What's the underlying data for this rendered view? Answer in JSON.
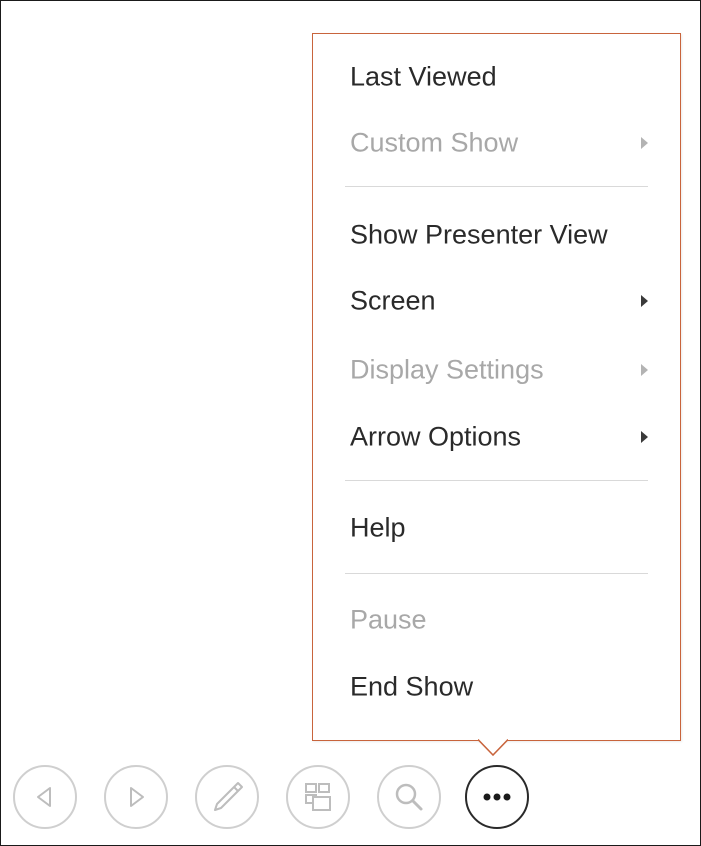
{
  "menu": {
    "items": [
      {
        "label": "Last Viewed",
        "disabled": false,
        "submenu": false
      },
      {
        "label": "Custom Show",
        "disabled": true,
        "submenu": true
      },
      {
        "label": "Show Presenter View",
        "disabled": false,
        "submenu": false
      },
      {
        "label": "Screen",
        "disabled": false,
        "submenu": true
      },
      {
        "label": "Display Settings",
        "disabled": true,
        "submenu": true
      },
      {
        "label": "Arrow Options",
        "disabled": false,
        "submenu": true
      },
      {
        "label": "Help",
        "disabled": false,
        "submenu": false
      },
      {
        "label": "Pause",
        "disabled": true,
        "submenu": false
      },
      {
        "label": "End Show",
        "disabled": false,
        "submenu": false
      }
    ]
  },
  "toolbar": {
    "buttons": [
      {
        "name": "previous-slide-button",
        "icon": "triangle-left-icon",
        "active": false
      },
      {
        "name": "next-slide-button",
        "icon": "triangle-right-icon",
        "active": false
      },
      {
        "name": "pen-button",
        "icon": "pen-icon",
        "active": false
      },
      {
        "name": "see-all-slides-button",
        "icon": "slides-grid-icon",
        "active": false
      },
      {
        "name": "zoom-button",
        "icon": "magnifier-icon",
        "active": false
      },
      {
        "name": "more-options-button",
        "icon": "ellipsis-icon",
        "active": true
      }
    ]
  },
  "colors": {
    "menu_border": "#c8643c",
    "text": "#2a2a2a",
    "disabled_text": "#a8a8a8",
    "control_border": "#cfcfcf"
  }
}
